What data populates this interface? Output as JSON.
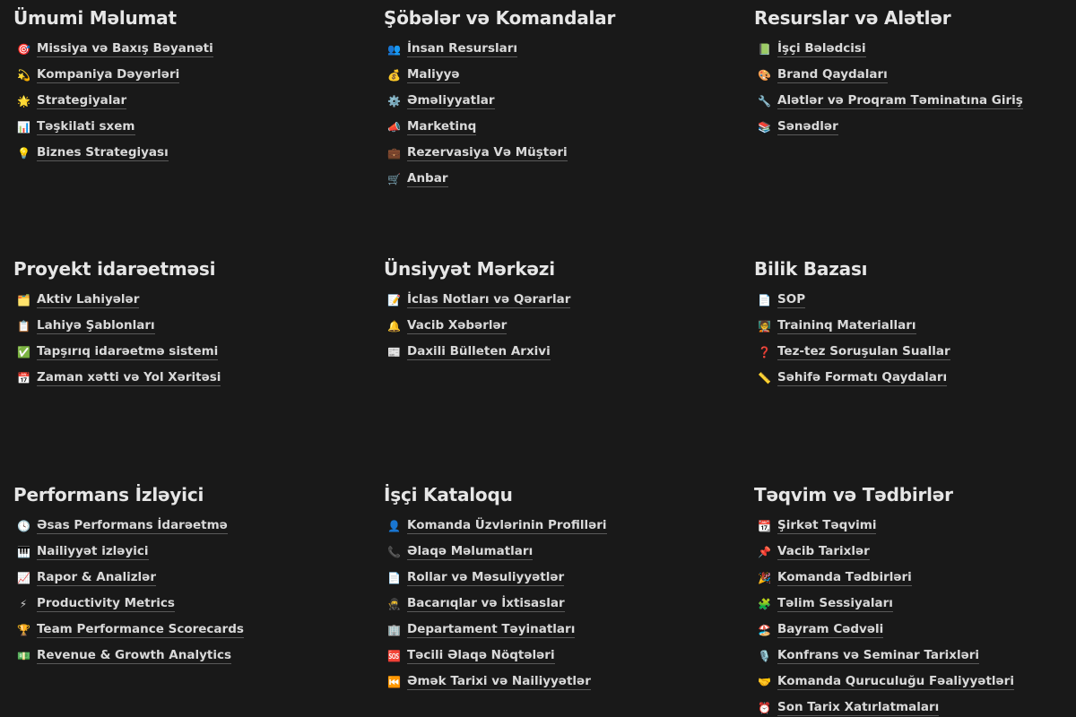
{
  "sections": [
    {
      "title": "Ümumi Məlumat",
      "items": [
        {
          "emoji": "🎯",
          "icon": "target-icon",
          "label": "Missiya və Baxış Bəyanəti"
        },
        {
          "emoji": "💫",
          "icon": "dizzy-star-icon",
          "label": "Kompaniya Dəyərləri"
        },
        {
          "emoji": "🌟",
          "icon": "glowing-star-icon",
          "label": "Strategiyalar"
        },
        {
          "emoji": "📊",
          "icon": "bar-chart-icon",
          "label": "Təşkilati sxem"
        },
        {
          "emoji": "💡",
          "icon": "light-bulb-icon",
          "label": "Biznes Strategiyası"
        }
      ]
    },
    {
      "title": "Şöbələr və Komandalar",
      "items": [
        {
          "emoji": "👥",
          "icon": "people-icon",
          "label": "İnsan Resursları"
        },
        {
          "emoji": "💰",
          "icon": "money-bag-icon",
          "label": "Maliyyə"
        },
        {
          "emoji": "⚙️",
          "icon": "gear-icon",
          "label": "Əməliyyatlar"
        },
        {
          "emoji": "📣",
          "icon": "megaphone-icon",
          "label": "Marketinq"
        },
        {
          "emoji": "💼",
          "icon": "briefcase-icon",
          "label": "Rezervasiya Və Müştəri"
        },
        {
          "emoji": "🛒",
          "icon": "cart-icon",
          "label": "Anbar"
        }
      ]
    },
    {
      "title": "Resurslar və Alətlər",
      "items": [
        {
          "emoji": "📗",
          "icon": "green-book-icon",
          "label": "İşçi Bələdcisi"
        },
        {
          "emoji": "🎨",
          "icon": "palette-icon",
          "label": "Brand Qaydaları"
        },
        {
          "emoji": "🔧",
          "icon": "wrench-icon",
          "label": "Alətlər və Proqram Təminatına Giriş"
        },
        {
          "emoji": "📚",
          "icon": "books-icon",
          "label": "Sənədlər"
        }
      ]
    },
    {
      "title": "Proyekt idarəetməsi",
      "items": [
        {
          "emoji": "🗂️",
          "icon": "folder-icon",
          "label": "Aktiv Lahiyələr"
        },
        {
          "emoji": "📋",
          "icon": "clipboard-icon",
          "label": "Lahiyə Şablonları"
        },
        {
          "emoji": "✅",
          "icon": "check-mark-icon",
          "label": "Tapşırıq idarəetmə sistemi"
        },
        {
          "emoji": "📅",
          "icon": "calendar-icon",
          "label": "Zaman xətti və Yol Xəritəsi"
        }
      ]
    },
    {
      "title": "Ünsiyyət Mərkəzi",
      "items": [
        {
          "emoji": "📝",
          "icon": "memo-icon",
          "label": "İclas Notları və Qərarlar"
        },
        {
          "emoji": "🔔",
          "icon": "bell-icon",
          "label": "Vacib Xəbərlər"
        },
        {
          "emoji": "📰",
          "icon": "newspaper-icon",
          "label": "Daxili Bülleten Arxivi"
        }
      ]
    },
    {
      "title": "Bilik Bazası",
      "items": [
        {
          "emoji": "📄",
          "icon": "document-icon",
          "label": "SOP"
        },
        {
          "emoji": "🧑‍🏫",
          "icon": "teacher-icon",
          "label": "Traininq Materialları"
        },
        {
          "emoji": "❓",
          "icon": "question-mark-icon",
          "label": "Tez-tez Soruşulan Suallar"
        },
        {
          "emoji": "📏",
          "icon": "ruler-icon",
          "label": "Səhifə Formatı Qaydaları"
        }
      ]
    },
    {
      "title": "Performans İzləyici",
      "items": [
        {
          "emoji": "🕓",
          "icon": "clock-icon",
          "label": "Əsas Performans İdarəetmə"
        },
        {
          "emoji": "🎹",
          "icon": "keyboard-icon",
          "label": "Nailiyyət izləyici"
        },
        {
          "emoji": "📈",
          "icon": "chart-increasing-icon",
          "label": "Rapor & Analizlər"
        },
        {
          "emoji": "⚡",
          "icon": "lightning-icon",
          "label": "Productivity Metrics"
        },
        {
          "emoji": "🏆",
          "icon": "trophy-icon",
          "label": "Team Performance Scorecards"
        },
        {
          "emoji": "💵",
          "icon": "dollar-banknote-icon",
          "label": "Revenue & Growth Analytics"
        }
      ]
    },
    {
      "title": "İşçi Kataloqu",
      "items": [
        {
          "emoji": "👤",
          "icon": "person-icon",
          "label": "Komanda Üzvlərinin Profilləri"
        },
        {
          "emoji": "📞",
          "icon": "telephone-icon",
          "label": "Əlaqə Məlumatları"
        },
        {
          "emoji": "📄",
          "icon": "document-icon",
          "label": "Rollar və Məsuliyyətlər"
        },
        {
          "emoji": "🥷",
          "icon": "ninja-icon",
          "label": "Bacarıqlar və İxtisaslar"
        },
        {
          "emoji": "🏢",
          "icon": "office-building-icon",
          "label": "Departament Təyinatları"
        },
        {
          "emoji": "🆘",
          "icon": "sos-icon",
          "label": "Təcili Əlaqə Nöqtələri"
        },
        {
          "emoji": "⏮️",
          "icon": "rewind-icon",
          "label": "Əmək Tarixi və Nailiyyətlər"
        }
      ]
    },
    {
      "title": "Təqvim və Tədbirlər",
      "items": [
        {
          "emoji": "📆",
          "icon": "calendar-icon",
          "label": "Şirkət Təqvimi"
        },
        {
          "emoji": "📌",
          "icon": "pushpin-icon",
          "label": "Vacib Tarixlər"
        },
        {
          "emoji": "🎉",
          "icon": "party-popper-icon",
          "label": "Komanda Tədbirləri"
        },
        {
          "emoji": "🧩",
          "icon": "puzzle-icon",
          "label": "Təlim Sessiyaları"
        },
        {
          "emoji": "🏖️",
          "icon": "beach-umbrella-icon",
          "label": "Bayram Cədvəli"
        },
        {
          "emoji": "🎙️",
          "icon": "microphone-icon",
          "label": "Konfrans və Seminar Tarixləri"
        },
        {
          "emoji": "🤝",
          "icon": "handshake-icon",
          "label": "Komanda Quruculuğu Fəaliyyətləri"
        },
        {
          "emoji": "⏰",
          "icon": "alarm-clock-icon",
          "label": "Son Tarix Xatırlatmaları"
        }
      ]
    }
  ]
}
